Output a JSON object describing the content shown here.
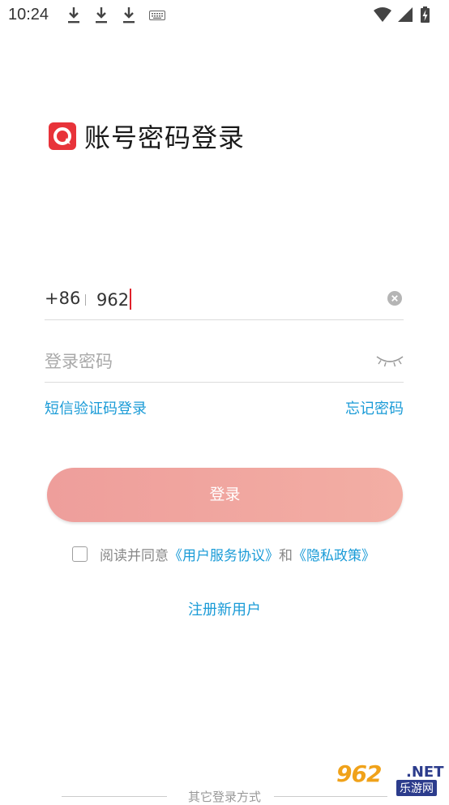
{
  "status_bar": {
    "time": "10:24"
  },
  "header": {
    "logo": "app-logo-icon",
    "title": "账号密码登录"
  },
  "form": {
    "country_code": "+86",
    "phone_value": "962",
    "password_placeholder": "登录密码",
    "sms_login_label": "短信验证码登录",
    "forgot_password_label": "忘记密码",
    "login_button_label": "登录",
    "agreement_prefix": "阅读并同意",
    "agreement_user_terms": "《用户服务协议》",
    "agreement_conjunction": "和",
    "agreement_privacy": "《隐私政策》",
    "register_label": "注册新用户",
    "other_login_label": "其它登录方式"
  },
  "watermark": {
    "brand": "962",
    "tld": ".NET",
    "sub": "乐游网"
  },
  "colors": {
    "accent_link": "#1a9bd7",
    "login_button": "#ee9e9b",
    "caret": "#e0212b",
    "logo": "#e8333a"
  }
}
